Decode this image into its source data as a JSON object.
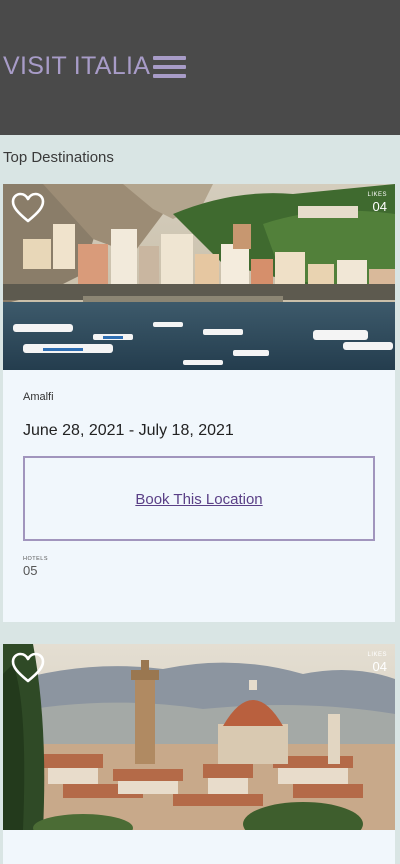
{
  "header": {
    "brand": "VISIT ITALIA",
    "menu_icon": "hamburger-menu-icon",
    "bg_color": "#4a4a4a",
    "accent_color": "#a89cc8"
  },
  "main": {
    "section_title": "Top Destinations",
    "cards": [
      {
        "photo": "Amalfi coastline photo",
        "heart_icon": "heart-outline-icon",
        "likes_label": "LIKES",
        "likes_count": "04",
        "place": "Amalfi",
        "dates": "June 28, 2021 - July 18, 2021",
        "book_label": "Book This Location",
        "hotels_label": "HOTELS",
        "hotels_count": "05"
      },
      {
        "photo": "Florence skyline photo",
        "heart_icon": "heart-outline-icon",
        "likes_label": "LIKES",
        "likes_count": "04"
      }
    ]
  }
}
